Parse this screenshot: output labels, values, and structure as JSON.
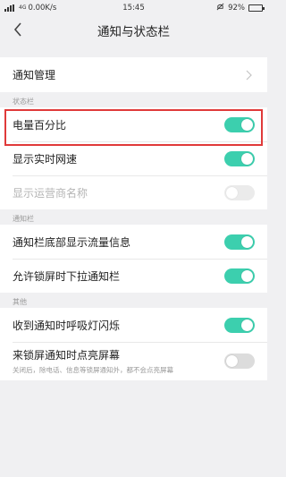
{
  "status_bar": {
    "signal": "4G",
    "network_speed": "0.00K/s",
    "time": "15:45",
    "battery": "92%",
    "battery_level": 0.92
  },
  "header": {
    "title": "通知与状态栏",
    "back_icon": "chevron-left-icon"
  },
  "notification_manage": {
    "label": "通知管理"
  },
  "sections": {
    "status_bar": {
      "title": "状态栏"
    },
    "notification_bar": {
      "title": "通知栏"
    },
    "other": {
      "title": "其他"
    }
  },
  "settings": {
    "battery_percent": {
      "label": "电量百分比",
      "state": "on"
    },
    "network_speed": {
      "label": "显示实时网速",
      "state": "on"
    },
    "carrier_name": {
      "label": "显示运营商名称",
      "state": "off",
      "enabled": false
    },
    "data_usage": {
      "label": "通知栏底部显示流量信息",
      "state": "on"
    },
    "lockscreen_pull": {
      "label": "允许锁屏时下拉通知栏",
      "state": "on"
    },
    "breathing_light": {
      "label": "收到通知时呼吸灯闪烁",
      "state": "on"
    },
    "wake_screen": {
      "label": "来锁屏通知时点亮屏幕",
      "description": "关闭后，除电话、信息等锁屏通知外，都不会点亮屏幕",
      "state": "off"
    }
  },
  "colors": {
    "toggle_on": "#3ccfae",
    "toggle_off": "#dcdcdc",
    "highlight": "#e03a3a"
  }
}
